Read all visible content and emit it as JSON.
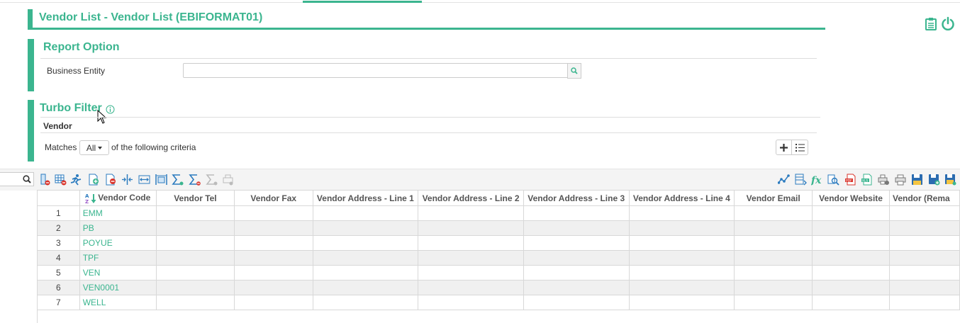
{
  "header": {
    "title": "Vendor List - Vendor List (EBIFORMAT01)"
  },
  "report_option": {
    "title": "Report Option",
    "business_entity_label": "Business Entity",
    "business_entity_value": ""
  },
  "turbo_filter": {
    "title": "Turbo Filter",
    "group_label": "Vendor",
    "matches_label": "Matches",
    "matches_value": "All",
    "criteria_text": "of the following criteria"
  },
  "colors": {
    "accent": "#3bb58f"
  },
  "grid": {
    "columns": [
      "",
      "Vendor Code",
      "Vendor Tel",
      "Vendor Fax",
      "Vendor Address - Line 1",
      "Vendor Address - Line 2",
      "Vendor Address - Line 3",
      "Vendor Address - Line 4",
      "Vendor Email",
      "Vendor Website",
      "Vendor (Rema"
    ],
    "rows": [
      {
        "num": "1",
        "code": "EMM"
      },
      {
        "num": "2",
        "code": "PB"
      },
      {
        "num": "3",
        "code": "POYUE"
      },
      {
        "num": "4",
        "code": "TPF"
      },
      {
        "num": "5",
        "code": "VEN"
      },
      {
        "num": "6",
        "code": "VEN0001"
      },
      {
        "num": "7",
        "code": "WELL"
      }
    ]
  }
}
